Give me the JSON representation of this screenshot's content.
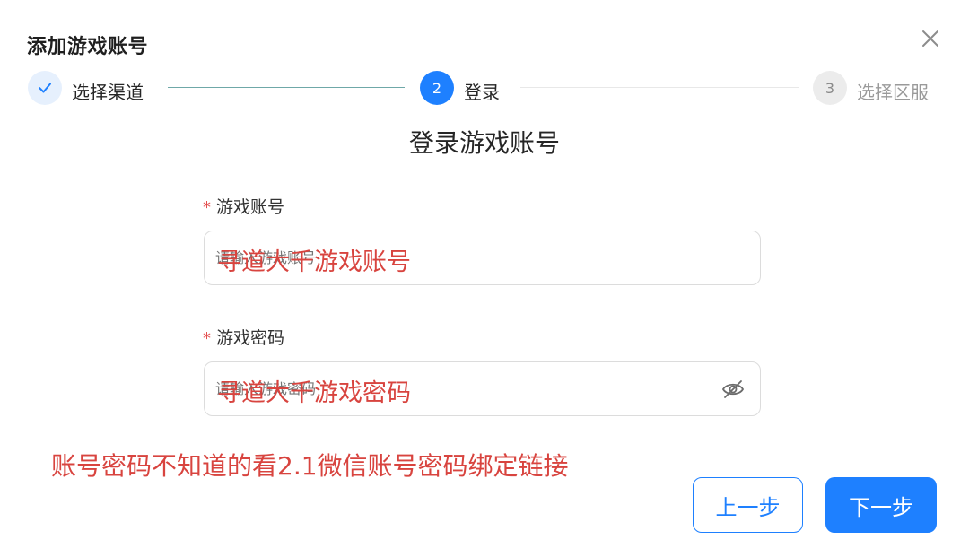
{
  "dialog": {
    "title": "添加游戏账号"
  },
  "steps": [
    {
      "index": "1",
      "label": "选择渠道",
      "status": "done"
    },
    {
      "index": "2",
      "label": "登录",
      "status": "active"
    },
    {
      "index": "3",
      "label": "选择区服",
      "status": "wait"
    }
  ],
  "form": {
    "heading": "登录游戏账号",
    "required_mark": "*",
    "account": {
      "label": "游戏账号",
      "placeholder": "请输入游戏账号",
      "overlay_text": "寻道大千游戏账号"
    },
    "password": {
      "label": "游戏密码",
      "placeholder": "请输入游戏密码",
      "overlay_text": "寻道大千游戏密码"
    }
  },
  "note": "账号密码不知道的看2.1微信账号密码绑定链接",
  "buttons": {
    "prev": "上一步",
    "next": "下一步"
  },
  "icons": {
    "close": "close-icon",
    "check": "check-icon",
    "eye": "eye-off-icon"
  },
  "colors": {
    "primary": "#1e80ff",
    "annotation_red": "#d8443f"
  }
}
